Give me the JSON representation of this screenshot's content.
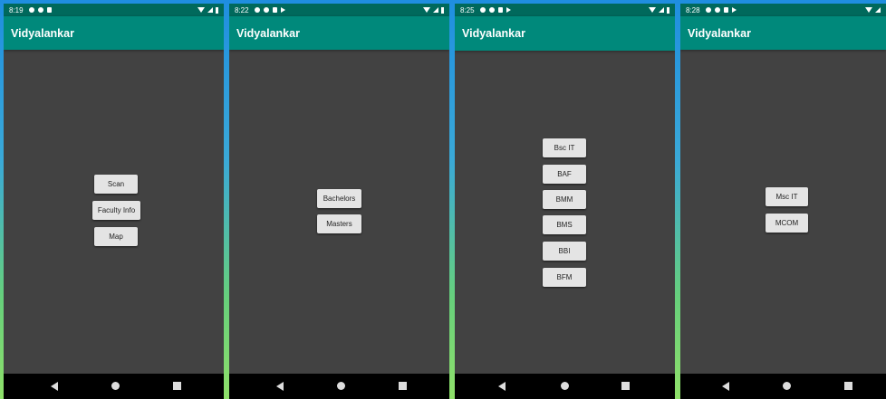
{
  "screens": [
    {
      "status_time": "8:19",
      "app_title": "Vidyalankar",
      "buttons": [
        "Scan",
        "Faculty Info",
        "Map"
      ]
    },
    {
      "status_time": "8:22",
      "app_title": "Vidyalankar",
      "buttons": [
        "Bachelors",
        "Masters"
      ]
    },
    {
      "status_time": "8:25",
      "app_title": "Vidyalankar",
      "buttons": [
        "Bsc IT",
        "BAF",
        "BMM",
        "BMS",
        "BBI",
        "BFM"
      ]
    },
    {
      "status_time": "8:28",
      "app_title": "Vidyalankar",
      "buttons": [
        "Msc IT",
        "MCOM"
      ]
    }
  ],
  "colors": {
    "status_bar": "#00695c",
    "app_bar": "#00897b",
    "screen_bg": "#424242",
    "button_bg": "#e4e4e4",
    "nav_bar": "#000000"
  },
  "icons": {
    "status_left": [
      "gear-icon",
      "shield-icon",
      "sd-card-icon",
      "play-icon"
    ],
    "status_right": [
      "wifi-icon",
      "signal-icon",
      "battery-icon"
    ],
    "nav": [
      "back-icon",
      "home-icon",
      "recents-icon"
    ]
  }
}
